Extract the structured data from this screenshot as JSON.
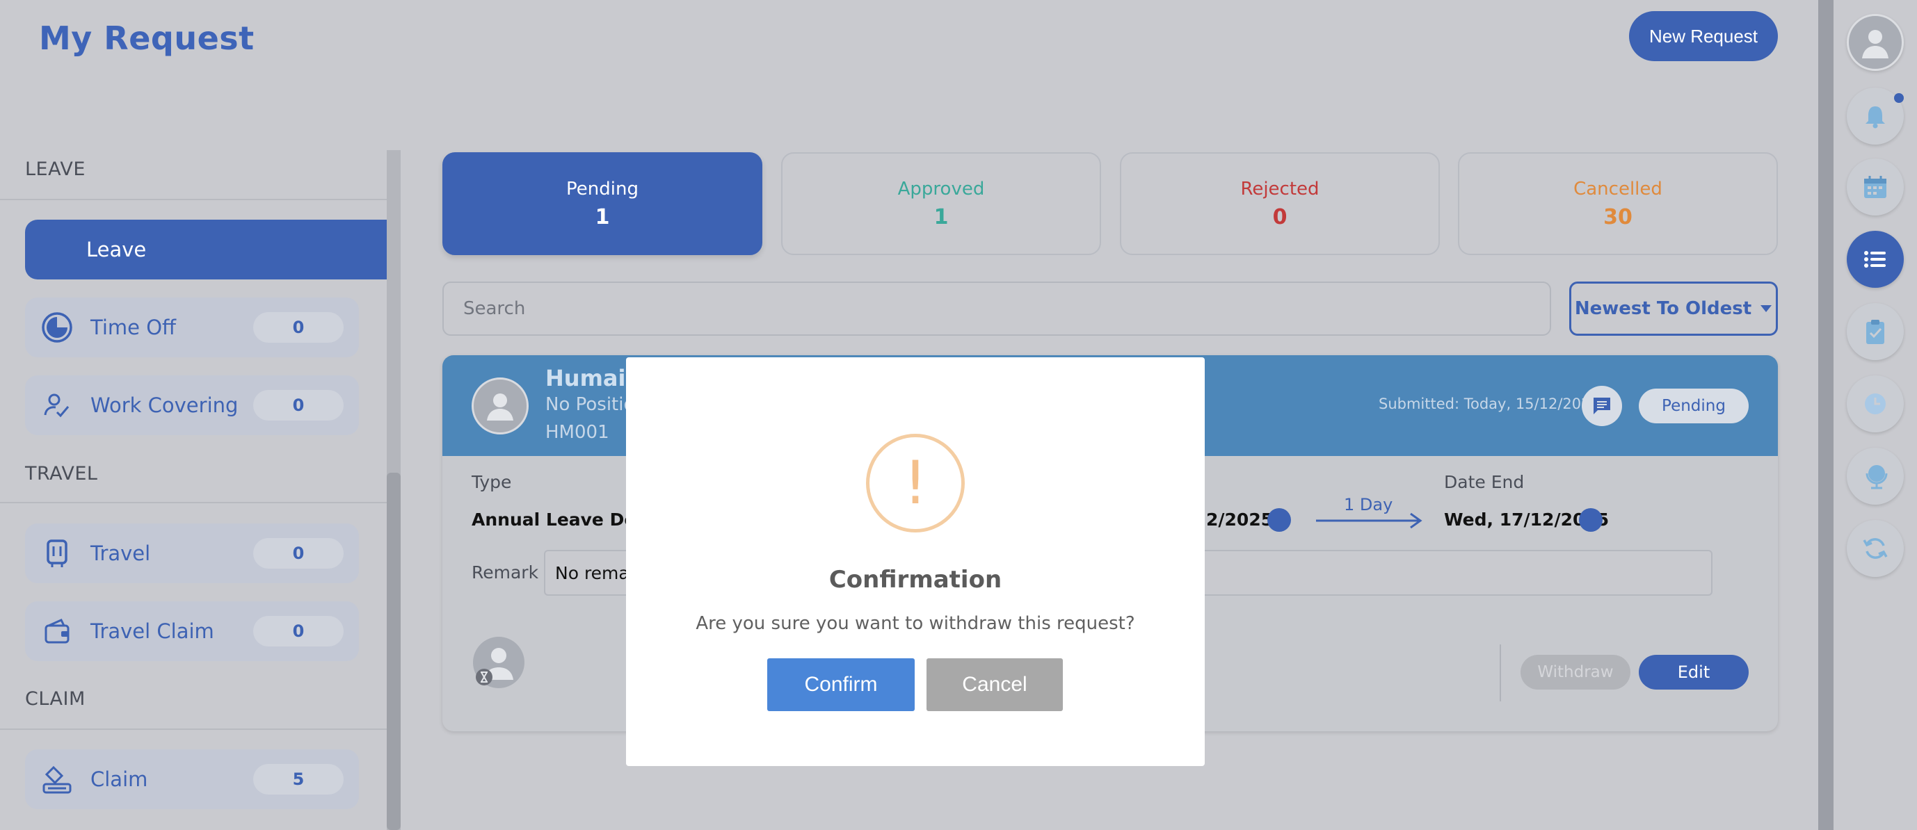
{
  "header": {
    "title": "My Request",
    "new_request_label": "New Request"
  },
  "sidebar": {
    "sections": [
      {
        "title": "LEAVE",
        "items": [
          {
            "label": "Leave",
            "icon": "leave-icon",
            "active": true
          },
          {
            "label": "Time Off",
            "count": "0",
            "icon": "time-off-icon"
          },
          {
            "label": "Work Covering",
            "count": "0",
            "icon": "work-covering-icon"
          }
        ]
      },
      {
        "title": "TRAVEL",
        "items": [
          {
            "label": "Travel",
            "count": "0",
            "icon": "travel-icon"
          },
          {
            "label": "Travel Claim",
            "count": "0",
            "icon": "wallet-icon"
          }
        ]
      },
      {
        "title": "CLAIM",
        "items": [
          {
            "label": "Claim",
            "count": "5",
            "icon": "claim-icon"
          }
        ]
      }
    ]
  },
  "stats": [
    {
      "label": "Pending",
      "value": "1",
      "color": "#ffffff",
      "active": true
    },
    {
      "label": "Approved",
      "value": "1",
      "color": "#3aa89a"
    },
    {
      "label": "Rejected",
      "value": "0",
      "color": "#c23a3a"
    },
    {
      "label": "Cancelled",
      "value": "30",
      "color": "#e08a3c"
    }
  ],
  "search": {
    "placeholder": "Search"
  },
  "sort": {
    "label": "Newest To Oldest"
  },
  "request": {
    "name": "Humaira",
    "position": "No Positio",
    "employee_id": "HM001",
    "submitted": "Submitted: Today, 15/12/2025",
    "status": "Pending",
    "type_label": "Type",
    "type_value": "Annual Leave Defau",
    "date_start_label": "t",
    "date_start_value": "2/2025",
    "duration": "1 Day",
    "date_end_label": "Date End",
    "date_end_value": "Wed, 17/12/2025",
    "remark_label": "Remark",
    "remark_value": "No remar",
    "withdraw_label": "Withdraw",
    "edit_label": "Edit"
  },
  "modal": {
    "icon": "!",
    "title": "Confirmation",
    "message": "Are you sure you want to withdraw this request?",
    "confirm_label": "Confirm",
    "cancel_label": "Cancel"
  },
  "rail": {
    "items": [
      "profile-icon",
      "notification-bell-icon",
      "calendar-icon",
      "list-icon",
      "clipboard-check-icon",
      "clock-icon",
      "globe-icon",
      "refresh-icon"
    ]
  },
  "colors": {
    "primary": "#3d62b3",
    "header_bar": "#4d87b9",
    "confirm": "#4a86d8",
    "warning": "#f4c08c"
  }
}
